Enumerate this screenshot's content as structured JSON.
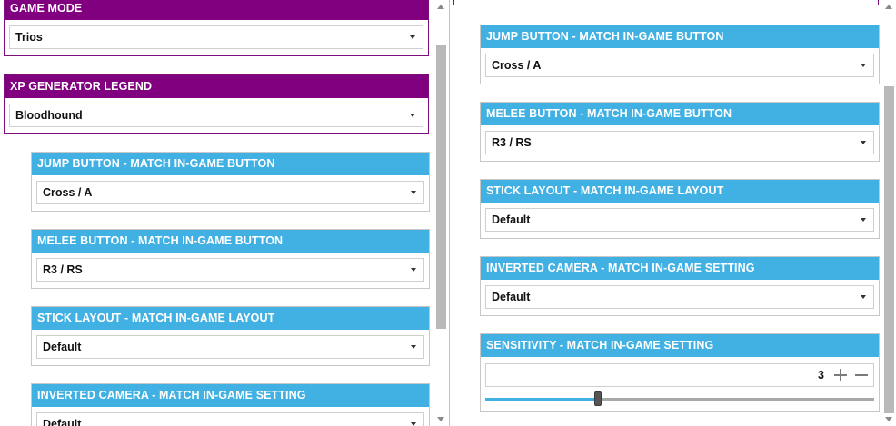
{
  "left": {
    "game_mode": {
      "title": "GAME MODE",
      "value": "Trios"
    },
    "xp_legend": {
      "title": "XP GENERATOR LEGEND",
      "value": "Bloodhound"
    },
    "jump": {
      "title": "JUMP BUTTON - MATCH IN-GAME BUTTON",
      "value": "Cross / A"
    },
    "melee": {
      "title": "MELEE BUTTON - MATCH IN-GAME BUTTON",
      "value": "R3 / RS"
    },
    "stick": {
      "title": "STICK LAYOUT - MATCH IN-GAME LAYOUT",
      "value": "Default"
    },
    "inverted": {
      "title": "INVERTED CAMERA - MATCH IN-GAME SETTING",
      "value": "Default"
    }
  },
  "right": {
    "jump": {
      "title": "JUMP BUTTON - MATCH IN-GAME BUTTON",
      "value": "Cross / A"
    },
    "melee": {
      "title": "MELEE BUTTON - MATCH IN-GAME BUTTON",
      "value": "R3 / RS"
    },
    "stick": {
      "title": "STICK LAYOUT - MATCH IN-GAME LAYOUT",
      "value": "Default"
    },
    "inverted": {
      "title": "INVERTED CAMERA - MATCH IN-GAME SETTING",
      "value": "Default"
    },
    "sensitivity": {
      "title": "SENSITIVITY - MATCH IN-GAME SETTING",
      "value": "3",
      "slider_fraction": 0.29
    }
  },
  "colors": {
    "purple": "#800080",
    "blue": "#41b0e2"
  },
  "icons": {
    "dropdown": "chevron-down-icon",
    "plus": "plus-icon",
    "minus": "minus-icon"
  }
}
